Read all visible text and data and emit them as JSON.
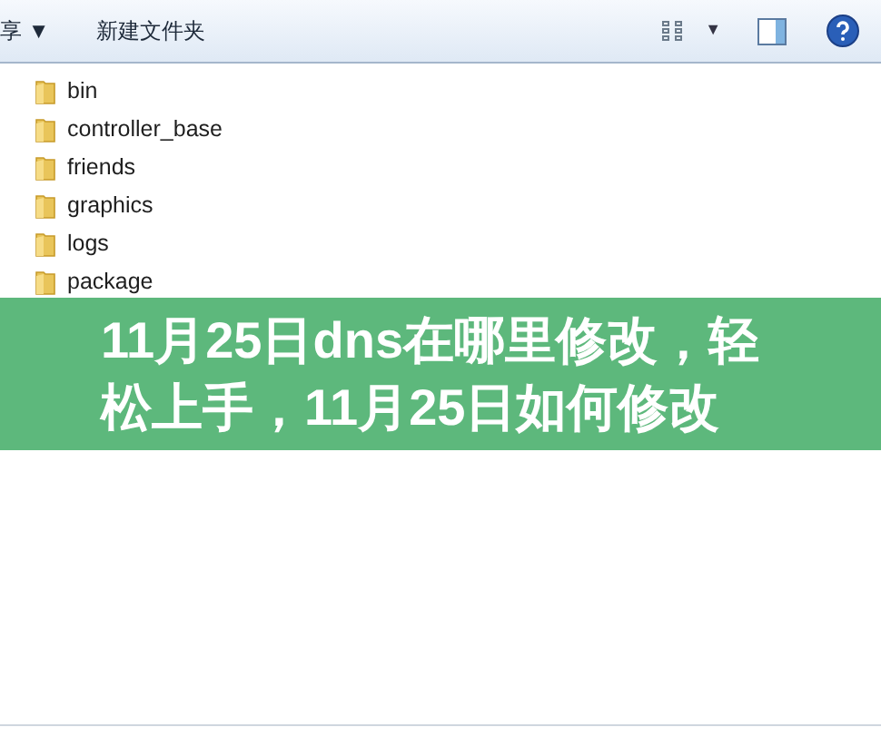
{
  "toolbar": {
    "share_menu": "享 ▼",
    "new_folder": "新建文件夹",
    "view_caret": "▼"
  },
  "files": [
    {
      "name": "bin",
      "kind": "folder"
    },
    {
      "name": "controller_base",
      "kind": "folder"
    },
    {
      "name": "friends",
      "kind": "folder"
    },
    {
      "name": "graphics",
      "kind": "folder"
    },
    {
      "name": "logs",
      "kind": "folder"
    },
    {
      "name": "package",
      "kind": "folder"
    }
  ],
  "banner": {
    "title": "11月25日dns在哪里修改，轻松上手，11月25日如何修改"
  }
}
